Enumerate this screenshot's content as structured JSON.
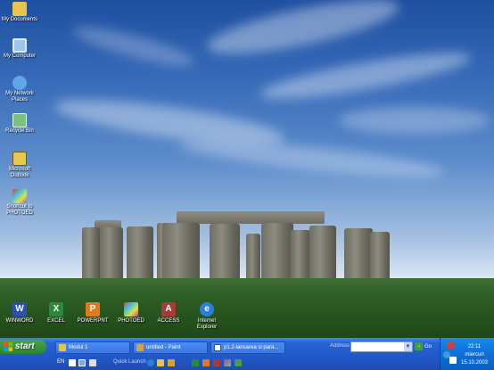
{
  "desktop": {
    "left_icons": [
      {
        "label": "My Documents",
        "icon": "folder-documents-icon",
        "color": "#e8c548"
      },
      {
        "label": "My Computer",
        "icon": "computer-icon",
        "color": "#9fc4ee"
      },
      {
        "label": "My Network Places",
        "icon": "network-places-icon",
        "color": "#5ea6e6"
      },
      {
        "label": "Recycle Bin",
        "icon": "recycle-bin-icon",
        "color": "#7cc07c"
      },
      {
        "label": "Microsoft Outlook",
        "icon": "outlook-icon",
        "color": "#e6c84a"
      },
      {
        "label": "Shortcut to PHOTOED",
        "icon": "photoed-shortcut-icon",
        "color": "#c050c0"
      }
    ],
    "app_icons": [
      {
        "label": "WINWORD",
        "icon": "word-icon",
        "color": "#2b4fb8",
        "glyph": "W"
      },
      {
        "label": "EXCEL",
        "icon": "excel-icon",
        "color": "#2a8a3a",
        "glyph": "X"
      },
      {
        "label": "POWERPNT",
        "icon": "powerpoint-icon",
        "color": "#e07a20",
        "glyph": "P"
      },
      {
        "label": "PHOTOED",
        "icon": "photoed-icon",
        "color": "#b040a8",
        "glyph": "✿"
      },
      {
        "label": "ACCESS",
        "icon": "access-icon",
        "color": "#a83a3a",
        "glyph": "A"
      },
      {
        "label": "Internet Explorer",
        "icon": "internet-explorer-icon",
        "color": "#2b7fdc",
        "glyph": "e"
      }
    ]
  },
  "taskbar": {
    "start_label": "start",
    "tasks": [
      {
        "label": "Modul 1",
        "icon": "folder-icon",
        "color": "#e8c548"
      },
      {
        "label": "untitled - Paint",
        "icon": "paint-icon",
        "color": "#d8a040"
      },
      {
        "label": "p1.2-lansarea si para...",
        "icon": "word-document-icon",
        "color": "#ffffff"
      }
    ],
    "address_label": "Address",
    "address_value": "",
    "go_label": "Go",
    "language": "EN",
    "quick_launch_label": "Quick Launch",
    "clock": {
      "time": "22:11",
      "day": "miercuri",
      "date": "15.10.2003"
    }
  }
}
